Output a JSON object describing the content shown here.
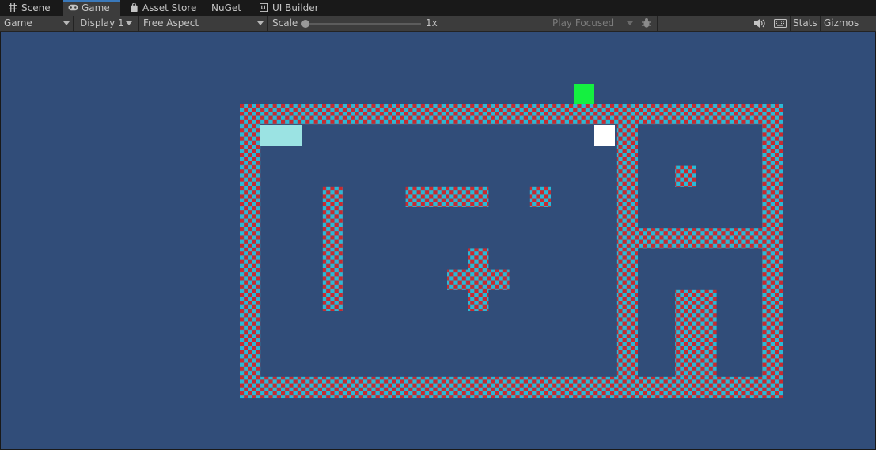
{
  "tabs": [
    {
      "label": "Scene",
      "icon": "grid-icon",
      "active": false
    },
    {
      "label": "Game",
      "icon": "gamepad-icon",
      "active": true
    },
    {
      "label": "Asset Store",
      "icon": "shopping-bag-icon",
      "active": false
    },
    {
      "label": "NuGet",
      "icon": "",
      "active": false
    },
    {
      "label": "UI Builder",
      "icon": "ui-builder-icon",
      "active": false
    }
  ],
  "toolbar": {
    "mode": "Game",
    "display": "Display 1",
    "aspect": "Free Aspect",
    "scale_label": "Scale",
    "scale_value": "1x",
    "play_mode": "Play Focused",
    "stats": "Stats",
    "gizmos": "Gizmos"
  },
  "colors": {
    "background": "#314d79",
    "wall_red": "#c82a2f",
    "wall_cyan": "#2ab9d6",
    "player": "#14f040",
    "start_block": "#9be3e3",
    "goal_block": "#ffffff"
  }
}
